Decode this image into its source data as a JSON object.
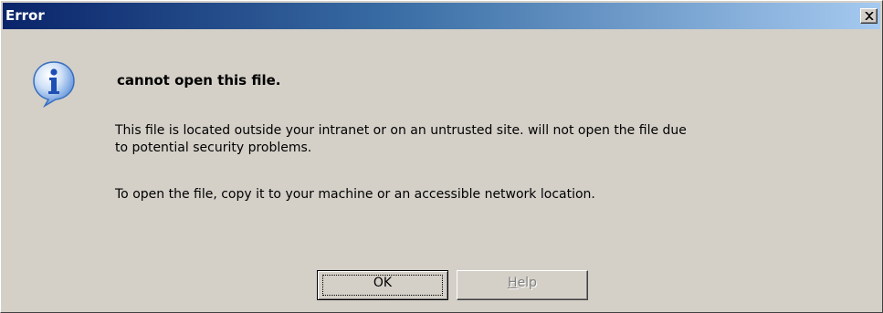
{
  "window": {
    "title": "Error"
  },
  "icons": {
    "close": "close-icon",
    "info": "info-icon",
    "colors": {
      "titlebar_start": "#0a246a",
      "titlebar_end": "#a6caf0",
      "dialog_bg": "#d4d0c8",
      "info_blue": "#2a6fd6"
    }
  },
  "message": {
    "heading": "cannot open this file.",
    "line1": "This file is located outside your intranet or on an untrusted site.   will not open the file due",
    "line2": "to potential security problems.",
    "line3": "To open the file, copy it to your machine or an accessible network location."
  },
  "buttons": {
    "ok_label": "OK",
    "help_label": "Help",
    "help_mnemonic": "H",
    "help_rest": "elp"
  }
}
